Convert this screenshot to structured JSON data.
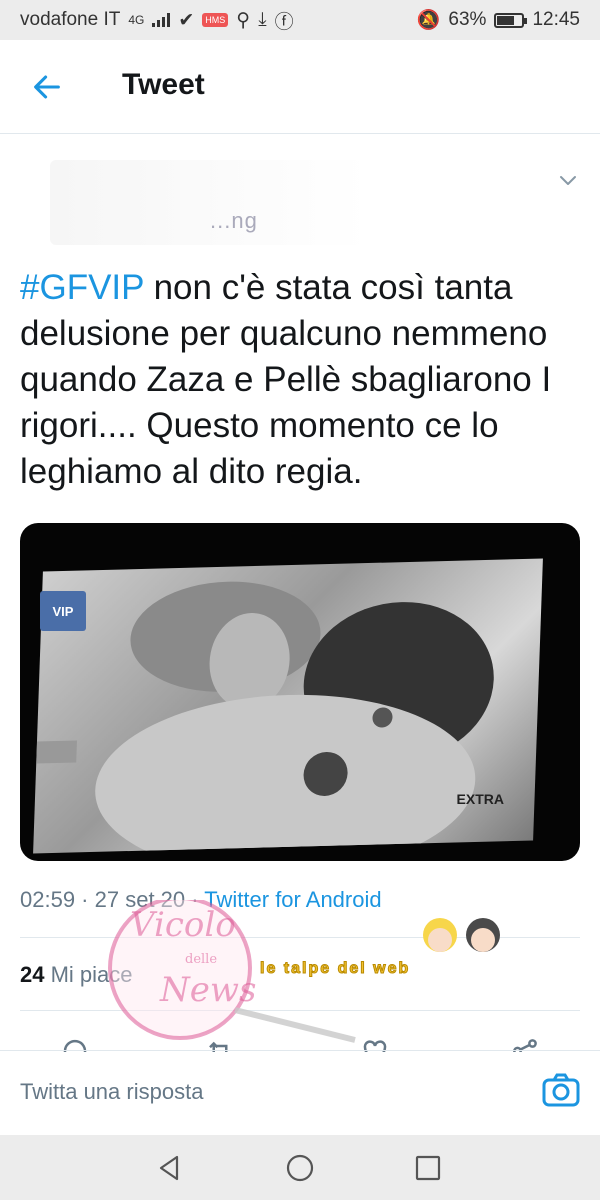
{
  "status_bar": {
    "carrier": "vodafone IT",
    "network": "4G",
    "badge": "HMS",
    "battery_percent": "63%",
    "battery_level": 0.63,
    "time": "12:45"
  },
  "header": {
    "back_icon": "arrow-left-icon",
    "title": "Tweet"
  },
  "author": {
    "handle_fragment": "...ng"
  },
  "tweet": {
    "hashtag": "#GFVIP",
    "text": " non c'è stata così tanta delusione per qualcuno nemmeno quando Zaza e Pellè sbagliarono I rigori.... Questo momento ce lo leghiamo al dito regia.",
    "media": {
      "logo_left": "VIP",
      "logo_right": "EXTRA"
    },
    "time": "02:59",
    "date": "27 set 20",
    "source": "Twitter for Android",
    "likes_count": "24",
    "likes_label": "Mi piace"
  },
  "reply": {
    "placeholder": "Twitta una risposta"
  },
  "watermark": {
    "line1": "Vicolo",
    "line2": "delle",
    "line3": "News",
    "tagline": "le talpe del web"
  },
  "colors": {
    "accent": "#1b95e0",
    "text": "#14171a",
    "muted": "#657786"
  }
}
